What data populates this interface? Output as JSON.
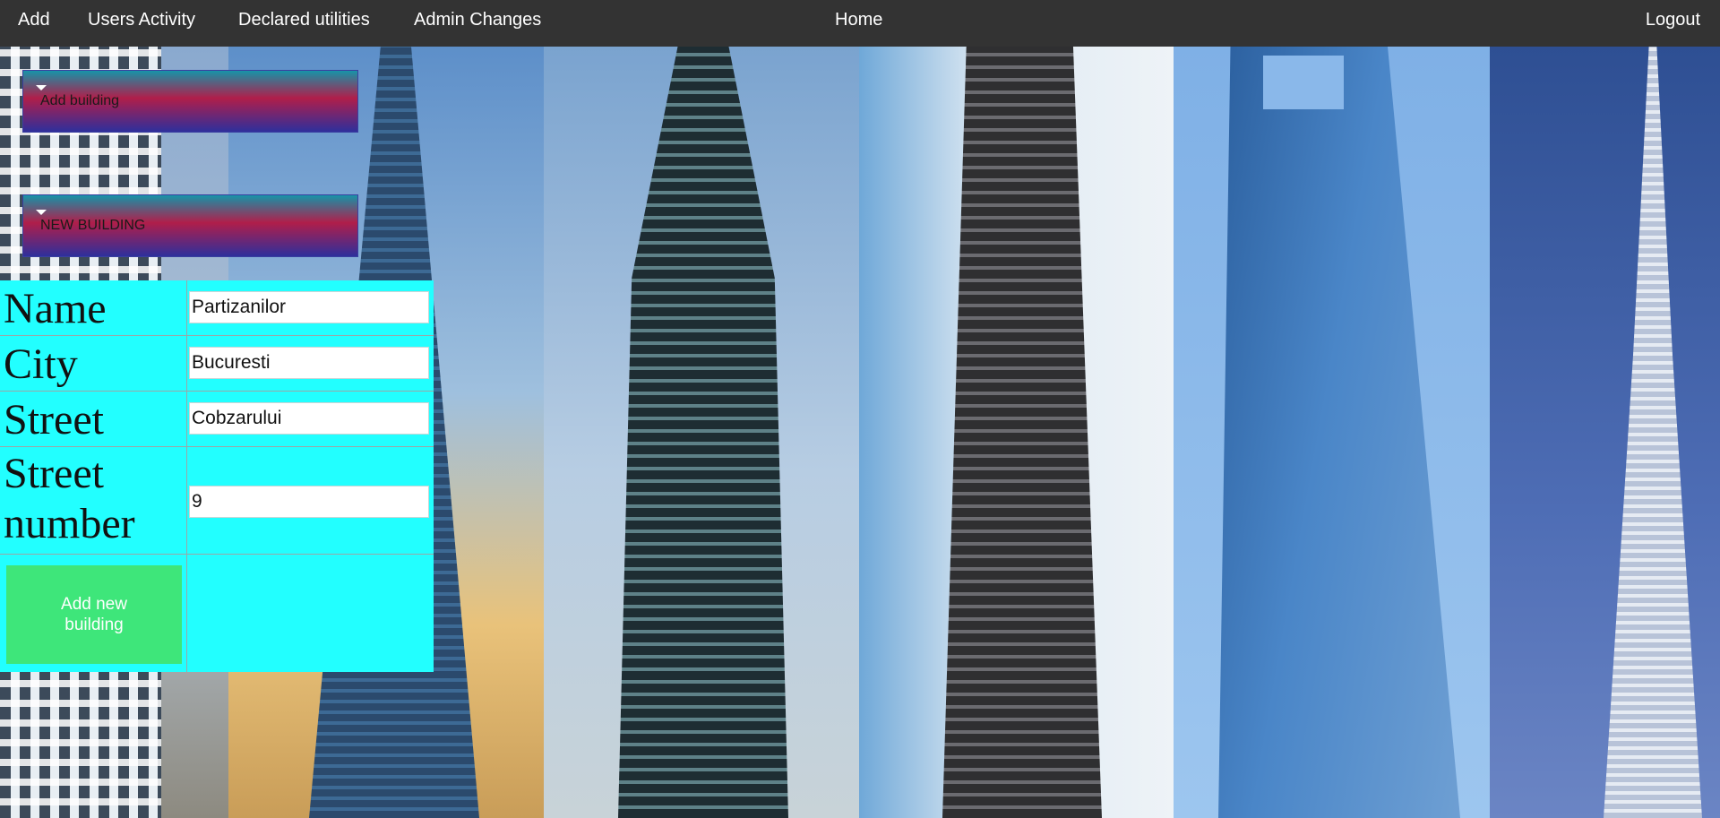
{
  "nav": {
    "add": "Add",
    "users_activity": "Users Activity",
    "declared_utilities": "Declared utilities",
    "admin_changes": "Admin Changes",
    "home": "Home",
    "logout": "Logout"
  },
  "sections": {
    "add_building": "Add building",
    "new_building": "NEW BUILDING"
  },
  "form": {
    "name_label": "Name",
    "name_value": "Partizanilor",
    "city_label": "City",
    "city_value": "Bucuresti",
    "street_label": "Street",
    "street_value": "Cobzarului",
    "street_number_label": "Street number",
    "street_number_value": "9",
    "submit_label": "Add new building"
  },
  "colors": {
    "nav_background": "#333333",
    "form_background": "#22ffff",
    "submit_background": "#3ee67a"
  }
}
